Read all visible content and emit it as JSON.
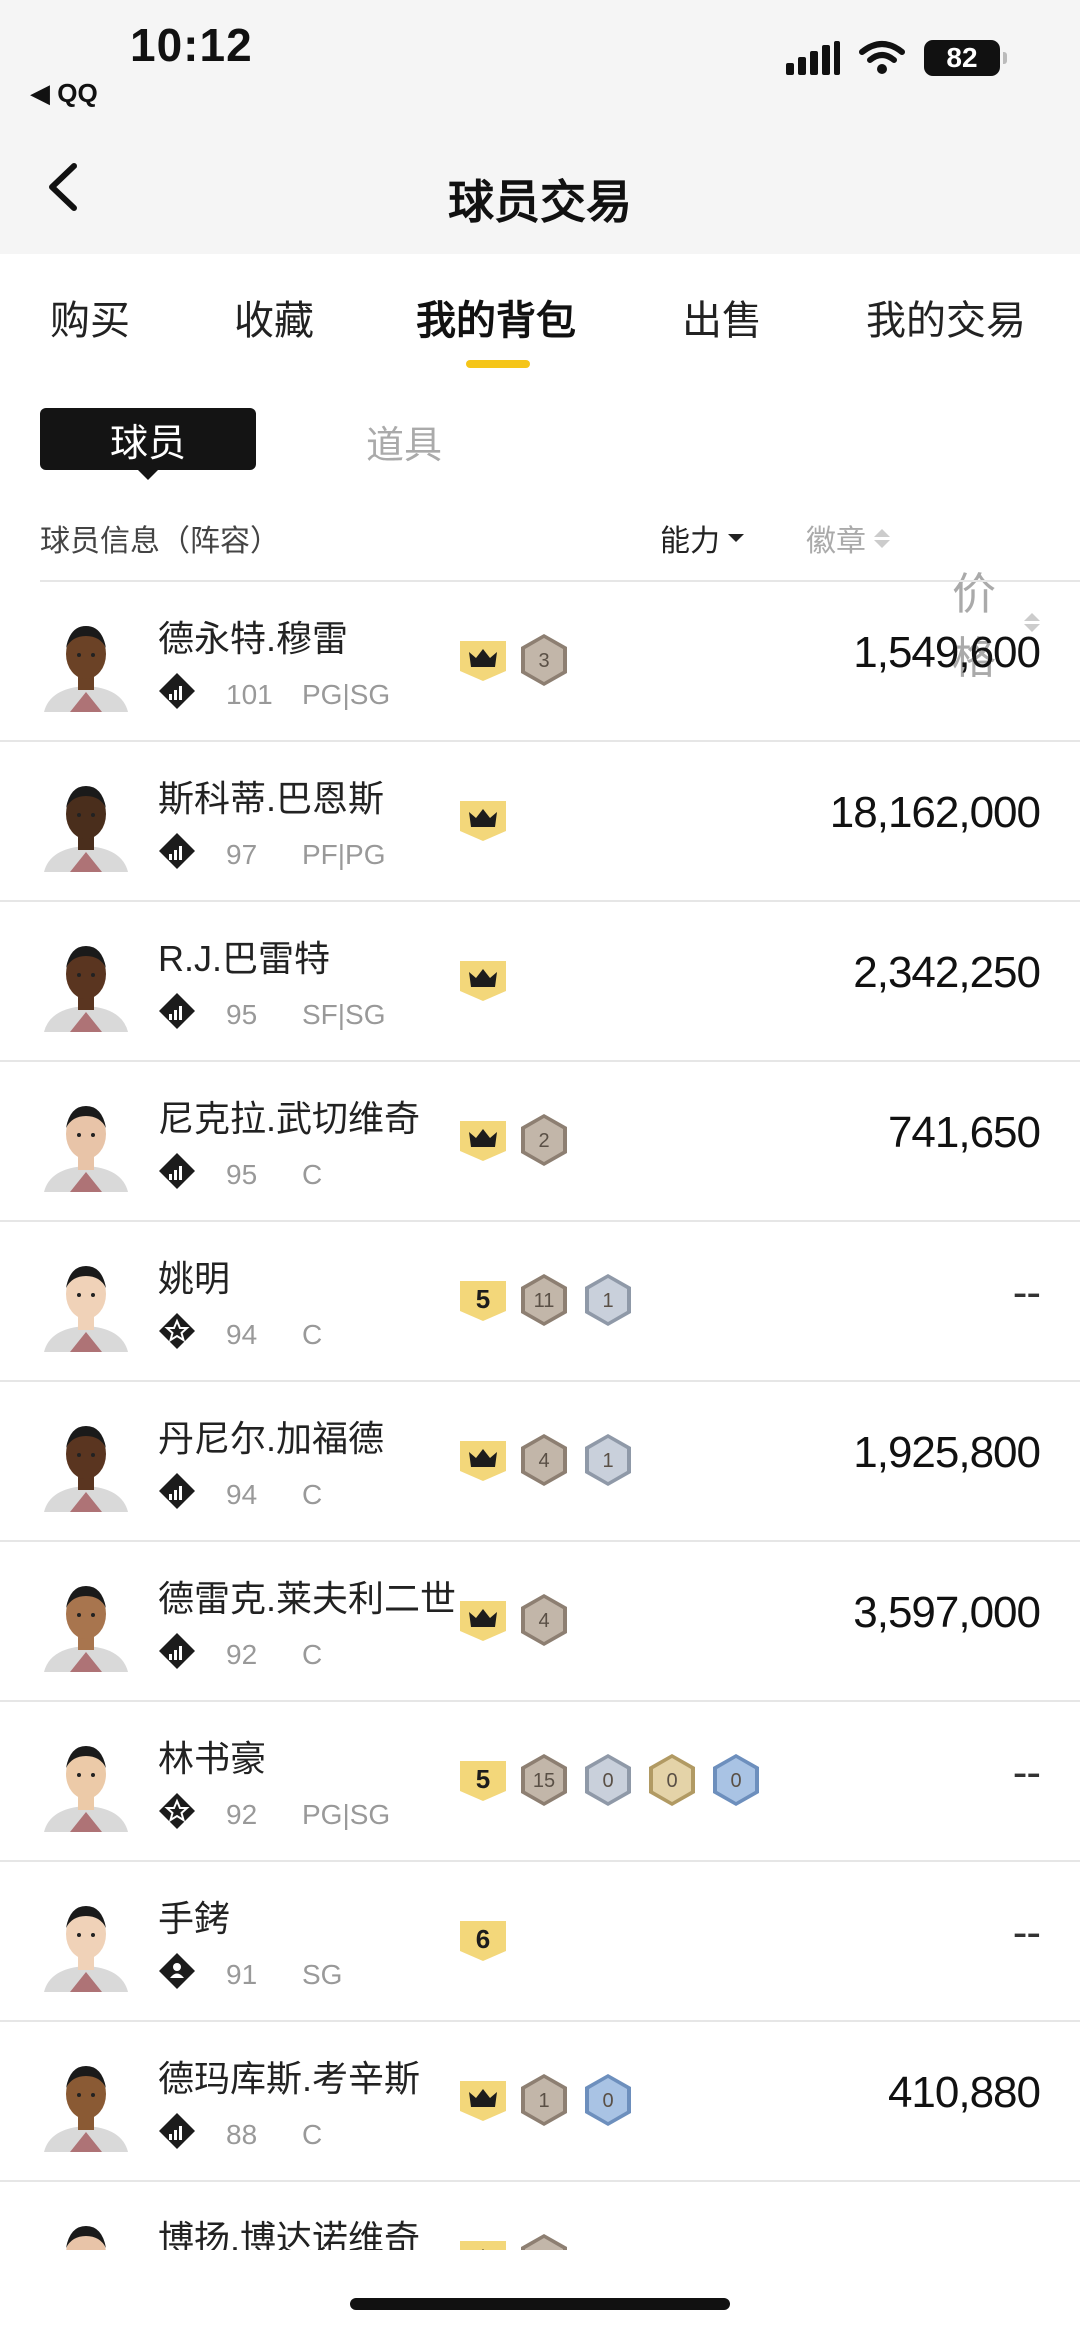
{
  "status_bar": {
    "time": "10:12",
    "back_app": "◀ QQ",
    "battery": "82"
  },
  "header": {
    "title": "球员交易"
  },
  "tabs": [
    {
      "label": "购买"
    },
    {
      "label": "收藏"
    },
    {
      "label": "我的背包",
      "active": true
    },
    {
      "label": "出售"
    },
    {
      "label": "我的交易"
    }
  ],
  "segments": {
    "player": "球员",
    "items": "道具"
  },
  "columns": {
    "info": "球员信息（阵容）",
    "ability": "能力",
    "badge": "徽章",
    "price": "价格"
  },
  "colors": {
    "accent": "#f5c518",
    "gold_tag": "#f3d77a",
    "bronze_hex": "#b0a396",
    "silver_hex": "#b7bfcc",
    "gold_hex": "#d6c08e",
    "blue_hex": "#8eaed6"
  },
  "players": [
    {
      "name": "德永特.穆雷",
      "ovr": "101",
      "pos": "PG|SG",
      "tier_icon": "signal-diamond-icon",
      "tag": "crown",
      "hexes": [
        {
          "value": "3",
          "color": "bronze"
        }
      ],
      "price": "1,549,600",
      "skin": "#6b4226"
    },
    {
      "name": "斯科蒂.巴恩斯",
      "ovr": "97",
      "pos": "PF|PG",
      "tier_icon": "signal-diamond-icon",
      "tag": "crown",
      "hexes": [],
      "price": "18,162,000",
      "skin": "#4a2e1c"
    },
    {
      "name": "R.J.巴雷特",
      "ovr": "95",
      "pos": "SF|SG",
      "tier_icon": "signal-diamond-icon",
      "tag": "crown",
      "hexes": [],
      "price": "2,342,250",
      "skin": "#5a3520"
    },
    {
      "name": "尼克拉.武切维奇",
      "ovr": "95",
      "pos": "C",
      "tier_icon": "signal-diamond-icon",
      "tag": "crown",
      "hexes": [
        {
          "value": "2",
          "color": "bronze"
        }
      ],
      "price": "741,650",
      "skin": "#e8c4a8"
    },
    {
      "name": "姚明",
      "ovr": "94",
      "pos": "C",
      "tier_icon": "star-diamond-icon",
      "tag": "5",
      "hexes": [
        {
          "value": "11",
          "color": "bronze"
        },
        {
          "value": "1",
          "color": "silver"
        }
      ],
      "price": "--",
      "skin": "#f0d2b8"
    },
    {
      "name": "丹尼尔.加福德",
      "ovr": "94",
      "pos": "C",
      "tier_icon": "signal-diamond-icon",
      "tag": "crown",
      "hexes": [
        {
          "value": "4",
          "color": "bronze"
        },
        {
          "value": "1",
          "color": "silver"
        }
      ],
      "price": "1,925,800",
      "skin": "#5a3520"
    },
    {
      "name": "德雷克.莱夫利二世",
      "ovr": "92",
      "pos": "C",
      "tier_icon": "signal-diamond-icon",
      "tag": "crown",
      "hexes": [
        {
          "value": "4",
          "color": "bronze"
        }
      ],
      "price": "3,597,000",
      "skin": "#a8754e"
    },
    {
      "name": "林书豪",
      "ovr": "92",
      "pos": "PG|SG",
      "tier_icon": "star-diamond-icon",
      "tag": "5",
      "hexes": [
        {
          "value": "15",
          "color": "bronze"
        },
        {
          "value": "0",
          "color": "silver"
        },
        {
          "value": "0",
          "color": "gold"
        },
        {
          "value": "0",
          "color": "blue"
        }
      ],
      "price": "--",
      "skin": "#eccaa8"
    },
    {
      "name": "手銬",
      "ovr": "91",
      "pos": "SG",
      "tier_icon": "person-diamond-icon",
      "tag": "6",
      "hexes": [],
      "price": "--",
      "skin": "#f0d2b8"
    },
    {
      "name": "德玛库斯.考辛斯",
      "ovr": "88",
      "pos": "C",
      "tier_icon": "signal-diamond-icon",
      "tag": "crown",
      "hexes": [
        {
          "value": "1",
          "color": "bronze"
        },
        {
          "value": "0",
          "color": "blue"
        }
      ],
      "price": "410,880",
      "skin": "#8a5a34"
    },
    {
      "name": "博扬.博达诺维奇",
      "ovr": "",
      "pos": "",
      "tier_icon": "signal-diamond-icon",
      "tag": "crown",
      "hexes": [
        {
          "value": "",
          "color": "bronze"
        }
      ],
      "price": "",
      "skin": "#e8c4a8"
    }
  ]
}
